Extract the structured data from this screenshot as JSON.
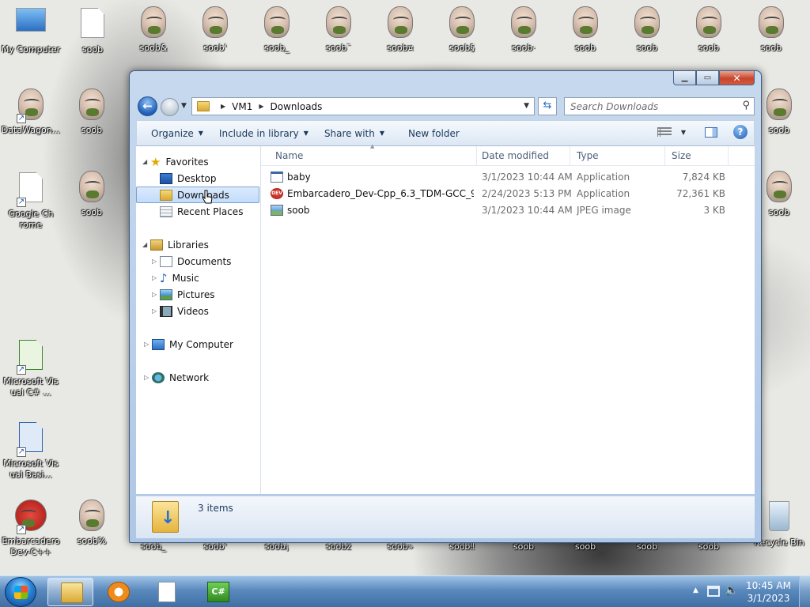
{
  "desktop": {
    "icons_top": [
      "My Computer",
      "soob",
      "soob&",
      "soob'",
      "soob_",
      "soob¨",
      "soob¤",
      "soob§",
      "soob·",
      "soob",
      "soob",
      "soob",
      "soob"
    ],
    "icons_left": [
      "DataWagon...",
      "Google Chrome",
      "Microsoft Visual C# ...",
      "Microsoft Visual Basi...",
      "Embarcadero Dev-C++"
    ],
    "icons_col2": [
      "soob",
      "soob",
      "soob%"
    ],
    "icons_right": [
      "soob",
      "soob",
      "Recycle Bin"
    ],
    "icons_bottom": [
      "soob_",
      "soob'",
      "soob¡",
      "soobž",
      "soob»",
      "soob‼",
      "soob",
      "soob",
      "soob",
      "soob"
    ]
  },
  "window": {
    "address": {
      "crumbs": [
        "VM1",
        "Downloads"
      ]
    },
    "search": {
      "placeholder": "Search Downloads"
    },
    "toolbar": {
      "organize": "Organize",
      "include_in_library": "Include in library",
      "share_with": "Share with",
      "new_folder": "New folder"
    },
    "nav": {
      "favorites": "Favorites",
      "desktop": "Desktop",
      "downloads": "Downloads",
      "recent_places": "Recent Places",
      "libraries": "Libraries",
      "documents": "Documents",
      "music": "Music",
      "pictures": "Pictures",
      "videos": "Videos",
      "my_computer": "My Computer",
      "network": "Network"
    },
    "columns": {
      "name": "Name",
      "date_modified": "Date modified",
      "type": "Type",
      "size": "Size"
    },
    "files": [
      {
        "name": "baby",
        "date": "3/1/2023 10:44 AM",
        "type": "Application",
        "size": "7,824 KB",
        "icon": "application-icon"
      },
      {
        "name": "Embarcadero_Dev-Cpp_6.3_TDM-GCC_9....",
        "date": "2/24/2023 5:13 PM",
        "type": "Application",
        "size": "72,361 KB",
        "icon": "dev-cpp-icon"
      },
      {
        "name": "soob",
        "date": "3/1/2023 10:44 AM",
        "type": "JPEG image",
        "size": "3 KB",
        "icon": "jpeg-icon"
      }
    ],
    "details": {
      "count": "3 items"
    }
  },
  "taskbar": {
    "clock_time": "10:45 AM",
    "clock_date": "3/1/2023"
  }
}
